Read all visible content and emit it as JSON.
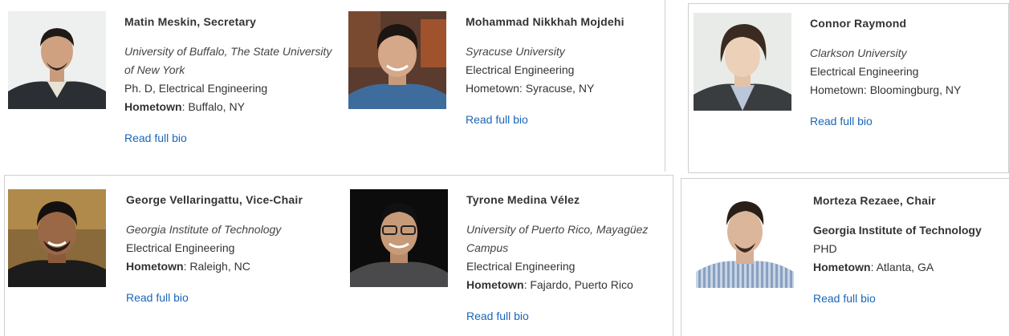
{
  "people": [
    {
      "name": "Matin Meskin, Secretary",
      "university": "University of Buffalo, The State University of New York",
      "university_style": "italic",
      "degree": "Ph. D, Electrical Engineering",
      "hometown_label": "Hometown",
      "hometown": "Buffalo, NY",
      "link": "Read full bio"
    },
    {
      "name": "Mohammad Nikkhah Mojdehi",
      "university": "Syracuse University",
      "university_style": "italic",
      "degree": "Electrical Engineering",
      "hometown_line": "Hometown: Syracuse, NY",
      "link": "Read full bio"
    },
    {
      "name": "Connor Raymond",
      "university": "Clarkson University",
      "university_style": "italic",
      "degree": "Electrical Engineering",
      "hometown_line": "Hometown: Bloomingburg, NY",
      "link": "Read full bio"
    },
    {
      "name": "George Vellaringattu, Vice-Chair",
      "university": "Georgia Institute of Technology",
      "university_style": "italic",
      "degree": "Electrical Engineering",
      "hometown_label": "Hometown",
      "hometown": "Raleigh, NC",
      "link": "Read full bio"
    },
    {
      "name": "Tyrone Medina Vélez",
      "university": "University of Puerto Rico, Mayagüez Campus",
      "university_style": "italic",
      "degree": "Electrical Engineering",
      "hometown_label": "Hometown",
      "hometown": "Fajardo, Puerto Rico",
      "link": "Read full bio"
    },
    {
      "name": "Morteza Rezaee, Chair",
      "university": "Georgia Institute of Technology",
      "university_style": "bold",
      "degree": "PHD",
      "hometown_label": "Hometown",
      "hometown": "Atlanta, GA",
      "link": "Read full bio"
    }
  ],
  "colors": {
    "link": "#1a66b8",
    "text": "#333333",
    "border": "#cfcfcf"
  }
}
